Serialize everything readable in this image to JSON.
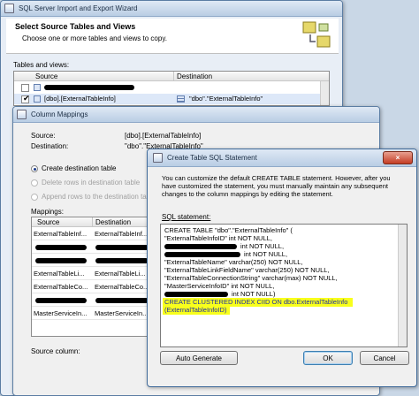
{
  "wizard": {
    "title": "SQL Server Import and Export Wizard",
    "heading": "Select Source Tables and Views",
    "subheading": "Choose one or more tables and views to copy.",
    "list_label": "Tables and views:",
    "col_source": "Source",
    "col_destination": "Destination",
    "row2_source": "[dbo].[ExternalTableInfo]",
    "row2_destination": "\"dbo\".\"ExternalTableInfo\""
  },
  "mappings": {
    "title": "Column Mappings",
    "source_label": "Source:",
    "source_value": "[dbo].[ExternalTableInfo]",
    "destination_label": "Destination:",
    "destination_value": "\"dbo\".\"ExternalTableInfo\"",
    "radio_create": "Create destination table",
    "radio_delete": "Delete rows in destination table",
    "radio_append": "Append rows to the destination table",
    "mappings_label": "Mappings:",
    "col_source": "Source",
    "col_destination": "Destination",
    "rows": [
      {
        "source": "ExternalTableInf...",
        "destination": "ExternalTableInf..."
      },
      {
        "source": "ExternalTableLi...",
        "destination": "ExternalTableLi..."
      },
      {
        "source": "ExternalTableCo...",
        "destination": "ExternalTableCo..."
      },
      {
        "source": "MasterServiceIn...",
        "destination": "MasterServiceIn..."
      }
    ],
    "source_column_label": "Source column:"
  },
  "sql_dialog": {
    "title": "Create Table SQL Statement",
    "description_1": "You can customize the default CREATE TABLE statement. However, after you",
    "description_2": "have customized the statement, you must manually maintain any subsequent",
    "description_3": "changes to the column mappings by editing the statement.",
    "sql_label": "SQL statement:",
    "lines": {
      "l1": "CREATE TABLE \"dbo\".\"ExternalTableInfo\" (",
      "l2": "\"ExternalTableInfoID\" int NOT NULL,",
      "l3": "int NOT NULL,",
      "l4": "int NOT NULL,",
      "l5": "\"ExternalTableName\" varchar(250) NOT NULL,",
      "l6": "\"ExternalTableLinkFieldName\" varchar(250) NOT NULL,",
      "l7": "\"ExternalTableConnectionString\" varchar(max) NOT NULL,",
      "l8": "\"MasterServiceInfoID\" int NOT NULL,",
      "l9": "int NOT NULL)",
      "l10": "CREATE CLUSTERED INDEX CIID ON dbo.ExternalTableInfo",
      "l11": "(ExternalTableInfoID)"
    },
    "auto_generate_label": "Auto Generate",
    "ok_label": "OK",
    "cancel_label": "Cancel",
    "close_symbol": "×"
  },
  "colors": {
    "highlight": "#f8ff1c",
    "title_gradient_top": "#dfe9f5",
    "title_gradient_bottom": "#b9cde4"
  }
}
